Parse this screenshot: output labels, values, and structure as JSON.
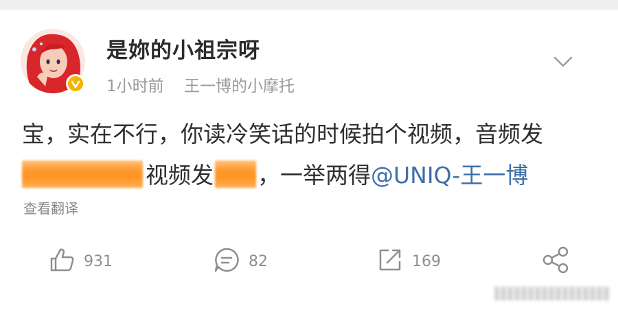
{
  "post": {
    "username": "是妳的小祖宗呀",
    "time": "1小时前",
    "source": "王一博的小摩托",
    "content": {
      "line1": "宝，实在不行，你读冷笑话的时候拍个视频，音频发",
      "line2_part1": "视频发",
      "line2_part2": "，一举两得",
      "mention": "@UNIQ-王一博"
    },
    "translate_label": "查看翻译"
  },
  "actions": {
    "likes": "931",
    "comments": "82",
    "reposts": "169"
  },
  "icons": {
    "like": "thumbs-up-icon",
    "comment": "comment-icon",
    "repost": "repost-icon",
    "share": "share-icon",
    "menu": "chevron-down-icon",
    "verified": "verified-badge-icon"
  },
  "colors": {
    "mention": "#3e6fa8",
    "badge": "#f2b400",
    "redaction": "#ff9a2e"
  }
}
